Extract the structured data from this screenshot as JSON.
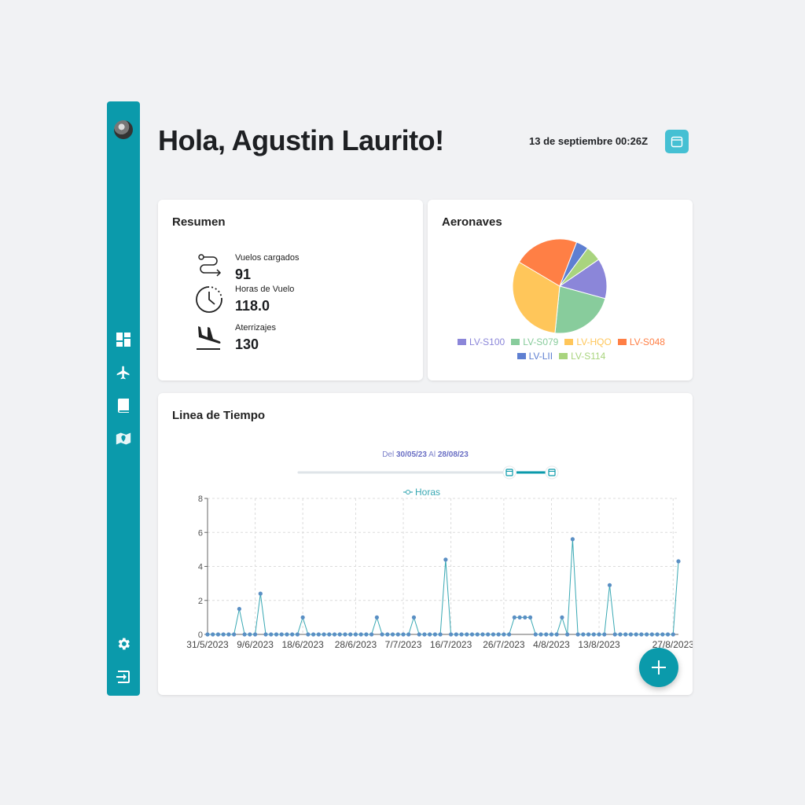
{
  "header": {
    "greeting": "Hola, Agustin Laurito!",
    "datetime": "13 de septiembre 00:26Z"
  },
  "sidebar": {
    "items": [
      {
        "name": "dashboard-icon"
      },
      {
        "name": "airplane-icon"
      },
      {
        "name": "book-icon"
      },
      {
        "name": "map-icon"
      }
    ],
    "bottom": [
      {
        "name": "gear-icon"
      },
      {
        "name": "logout-icon"
      }
    ]
  },
  "resumen": {
    "title": "Resumen",
    "stats": [
      {
        "label": "Vuelos cargados",
        "value": "91",
        "icon": "route-icon"
      },
      {
        "label": "Horas de Vuelo",
        "value": "118.0",
        "icon": "clock-icon"
      },
      {
        "label": "Aterrizajes",
        "value": "130",
        "icon": "landing-icon"
      }
    ]
  },
  "aeronaves": {
    "title": "Aeronaves",
    "legend_row1": [
      "LV-S100",
      "LV-S079",
      "LV-HQO",
      "LV-S048"
    ],
    "legend_row2": [
      "LV-LII",
      "LV-S114"
    ]
  },
  "timeline": {
    "title": "Linea de Tiempo",
    "range_prefix": "Del",
    "range_from": "30/05/23",
    "range_mid": "Al",
    "range_to": "28/08/23"
  },
  "colors": {
    "accent": "#0b9aab",
    "line": "#38a8b3",
    "point": "#5a8fc4"
  },
  "chart_data": [
    {
      "type": "pie",
      "title": "Aeronaves",
      "labels": [
        "LV-S100",
        "LV-S079",
        "LV-HQO",
        "LV-S048",
        "LV-LII",
        "LV-S114"
      ],
      "values": [
        13,
        21,
        30,
        21,
        4,
        5
      ],
      "colors": [
        "#8b86d9",
        "#88cc9c",
        "#ffc65a",
        "#ff7f45",
        "#5e7fd1",
        "#a9d47e"
      ]
    },
    {
      "type": "line",
      "series": [
        {
          "name": "Horas",
          "x": [
            "31/5/2023",
            "1/6/2023",
            "2/6/2023",
            "3/6/2023",
            "4/6/2023",
            "5/6/2023",
            "6/6/2023",
            "7/6/2023",
            "8/6/2023",
            "9/6/2023",
            "10/6/2023",
            "11/6/2023",
            "12/6/2023",
            "13/6/2023",
            "14/6/2023",
            "15/6/2023",
            "16/6/2023",
            "17/6/2023",
            "18/6/2023",
            "19/6/2023",
            "20/6/2023",
            "21/6/2023",
            "22/6/2023",
            "23/6/2023",
            "24/6/2023",
            "25/6/2023",
            "26/6/2023",
            "27/6/2023",
            "28/6/2023",
            "29/6/2023",
            "30/6/2023",
            "1/7/2023",
            "2/7/2023",
            "3/7/2023",
            "4/7/2023",
            "5/7/2023",
            "6/7/2023",
            "7/7/2023",
            "8/7/2023",
            "9/7/2023",
            "10/7/2023",
            "11/7/2023",
            "12/7/2023",
            "13/7/2023",
            "14/7/2023",
            "15/7/2023",
            "16/7/2023",
            "17/7/2023",
            "18/7/2023",
            "19/7/2023",
            "20/7/2023",
            "21/7/2023",
            "22/7/2023",
            "23/7/2023",
            "24/7/2023",
            "25/7/2023",
            "26/7/2023",
            "27/7/2023",
            "28/7/2023",
            "29/7/2023",
            "30/7/2023",
            "31/7/2023",
            "1/8/2023",
            "2/8/2023",
            "3/8/2023",
            "4/8/2023",
            "5/8/2023",
            "6/8/2023",
            "7/8/2023",
            "8/8/2023",
            "9/8/2023",
            "10/8/2023",
            "11/8/2023",
            "12/8/2023",
            "13/8/2023",
            "14/8/2023",
            "15/8/2023",
            "16/8/2023",
            "17/8/2023",
            "18/8/2023",
            "19/8/2023",
            "20/8/2023",
            "21/8/2023",
            "22/8/2023",
            "23/8/2023",
            "24/8/2023",
            "25/8/2023",
            "26/8/2023",
            "27/8/2023",
            "28/8/2023"
          ],
          "values": [
            0,
            0,
            0,
            0,
            0,
            0,
            1.5,
            0,
            0,
            0,
            2.4,
            0,
            0,
            0,
            0,
            0,
            0,
            0,
            1.0,
            0,
            0,
            0,
            0,
            0,
            0,
            0,
            0,
            0,
            0,
            0,
            0,
            0,
            1.0,
            0,
            0,
            0,
            0,
            0,
            0,
            1.0,
            0,
            0,
            0,
            0,
            0,
            4.4,
            0,
            0,
            0,
            0,
            0,
            0,
            0,
            0,
            0,
            0,
            0,
            0,
            1.0,
            1.0,
            1.0,
            1.0,
            0,
            0,
            0,
            0,
            0,
            1.0,
            0,
            5.6,
            0,
            0,
            0,
            0,
            0,
            0,
            2.9,
            0,
            0,
            0,
            0,
            0,
            0,
            0,
            0,
            0,
            0,
            0,
            0,
            4.3
          ]
        }
      ],
      "tick_labels": [
        "31/5/2023",
        "9/6/2023",
        "18/6/2023",
        "28/6/2023",
        "7/7/2023",
        "16/7/2023",
        "26/7/2023",
        "4/8/2023",
        "13/8/2023",
        "27/8/2023"
      ],
      "ylim": [
        0,
        8
      ],
      "yticks": [
        0,
        2,
        4,
        6,
        8
      ],
      "grid": true,
      "legend": "top-center"
    }
  ]
}
